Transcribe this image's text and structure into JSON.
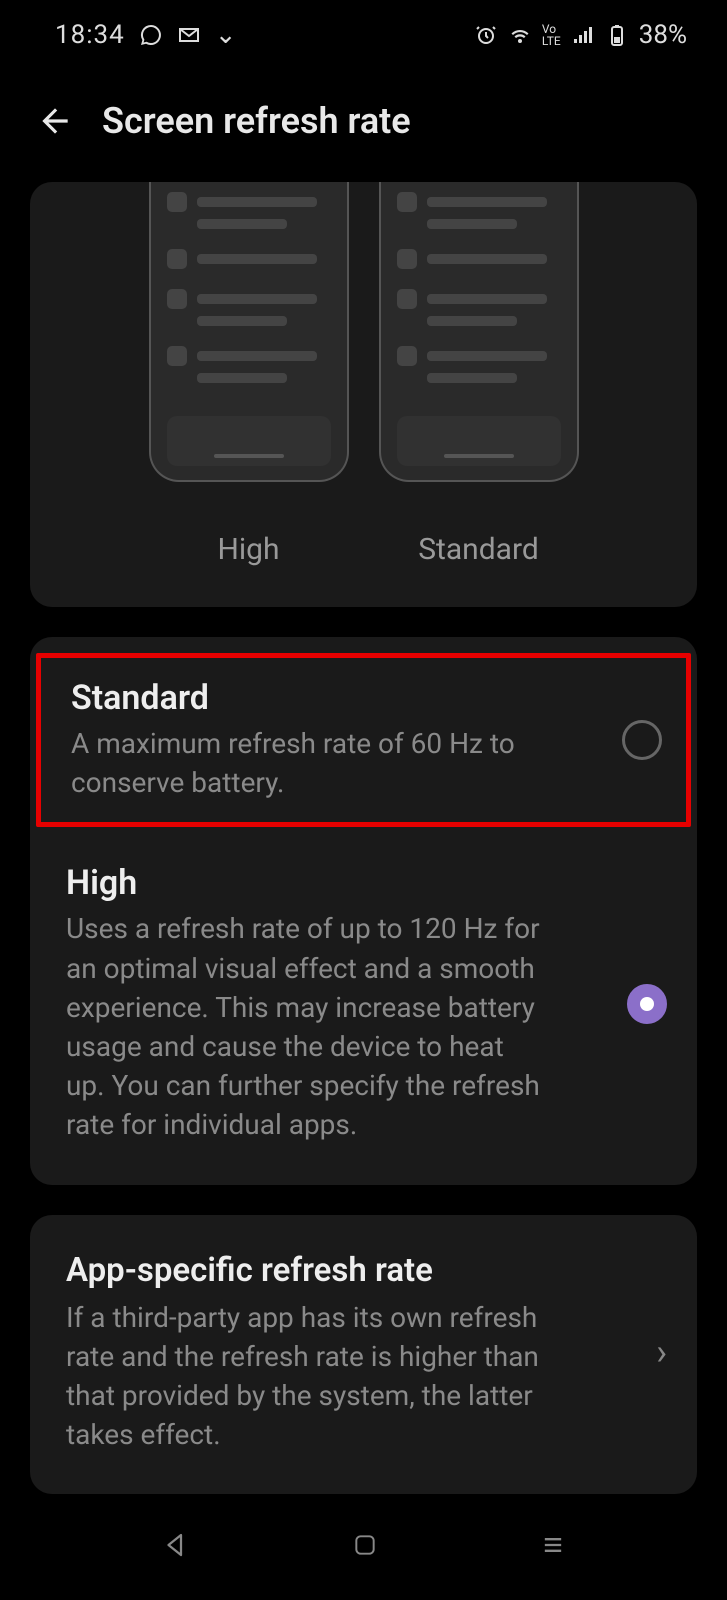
{
  "status": {
    "time": "18:34",
    "battery_text": "38%"
  },
  "header": {
    "title": "Screen refresh rate"
  },
  "preview": {
    "labels": [
      "High",
      "Standard"
    ]
  },
  "options": [
    {
      "title": "Standard",
      "desc": "A maximum refresh rate of 60 Hz to conserve battery.",
      "selected": false,
      "highlighted": true
    },
    {
      "title": "High",
      "desc": "Uses a refresh rate of up to 120 Hz for an optimal visual effect and a smooth experience. This may increase battery usage and cause the device to heat up. You can further specify the refresh rate for individual apps.",
      "selected": true,
      "highlighted": false
    }
  ],
  "apprate": {
    "title": "App-specific refresh rate",
    "desc": "If a third-party app has its own refresh rate and the refresh rate is higher than that provided by the system, the latter takes effect."
  }
}
